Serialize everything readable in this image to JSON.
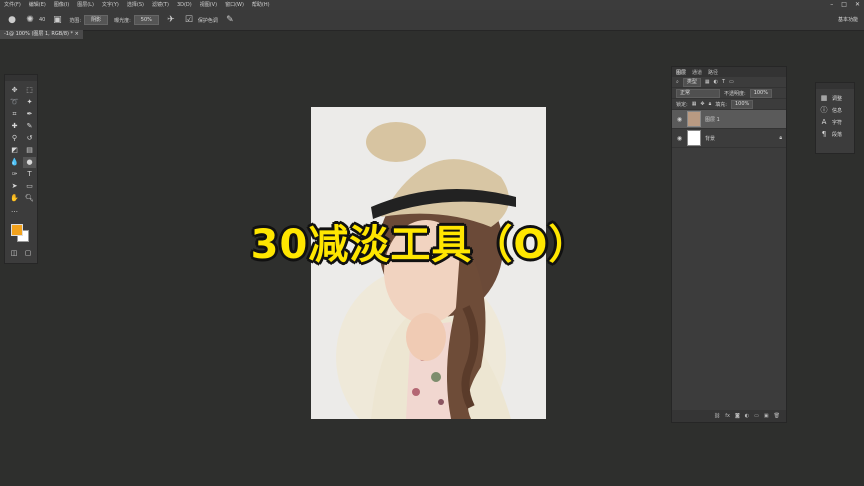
{
  "menubar": {
    "items": [
      "文件(F)",
      "编辑(E)",
      "图像(I)",
      "图层(L)",
      "文字(Y)",
      "选择(S)",
      "滤镜(T)",
      "3D(D)",
      "视图(V)",
      "窗口(W)",
      "帮助(H)"
    ]
  },
  "optionsbar": {
    "brush_size": "40",
    "range_label": "范围:",
    "range_value": "阴影",
    "exposure_label": "曝光度:",
    "exposure_value": "50%",
    "protect_tones": "保护色调"
  },
  "workspace": {
    "label": "基本功能"
  },
  "document": {
    "tab_label": "-1@ 100% (图层 1, RGB/8) *"
  },
  "overlay": {
    "title": "30减淡工具（O）"
  },
  "colors": {
    "foreground": "#f3a21c",
    "background": "#ffffff"
  },
  "layers_panel": {
    "tabs": [
      "图层",
      "通道",
      "路径"
    ],
    "filter": "类型",
    "blend_mode": "正常",
    "opacity_label": "不透明度:",
    "opacity_value": "100%",
    "lock_label": "锁定:",
    "fill_label": "填充:",
    "fill_value": "100%",
    "layers": [
      {
        "name": "图层 1",
        "selected": true
      },
      {
        "name": "背景",
        "selected": false
      }
    ]
  },
  "properties_panel": {
    "items": [
      {
        "icon": "adjust-icon",
        "label": "调整"
      },
      {
        "icon": "info-icon",
        "label": "信息"
      },
      {
        "icon": "character-icon",
        "label": "字符"
      },
      {
        "icon": "paragraph-icon",
        "label": "段落"
      }
    ]
  }
}
